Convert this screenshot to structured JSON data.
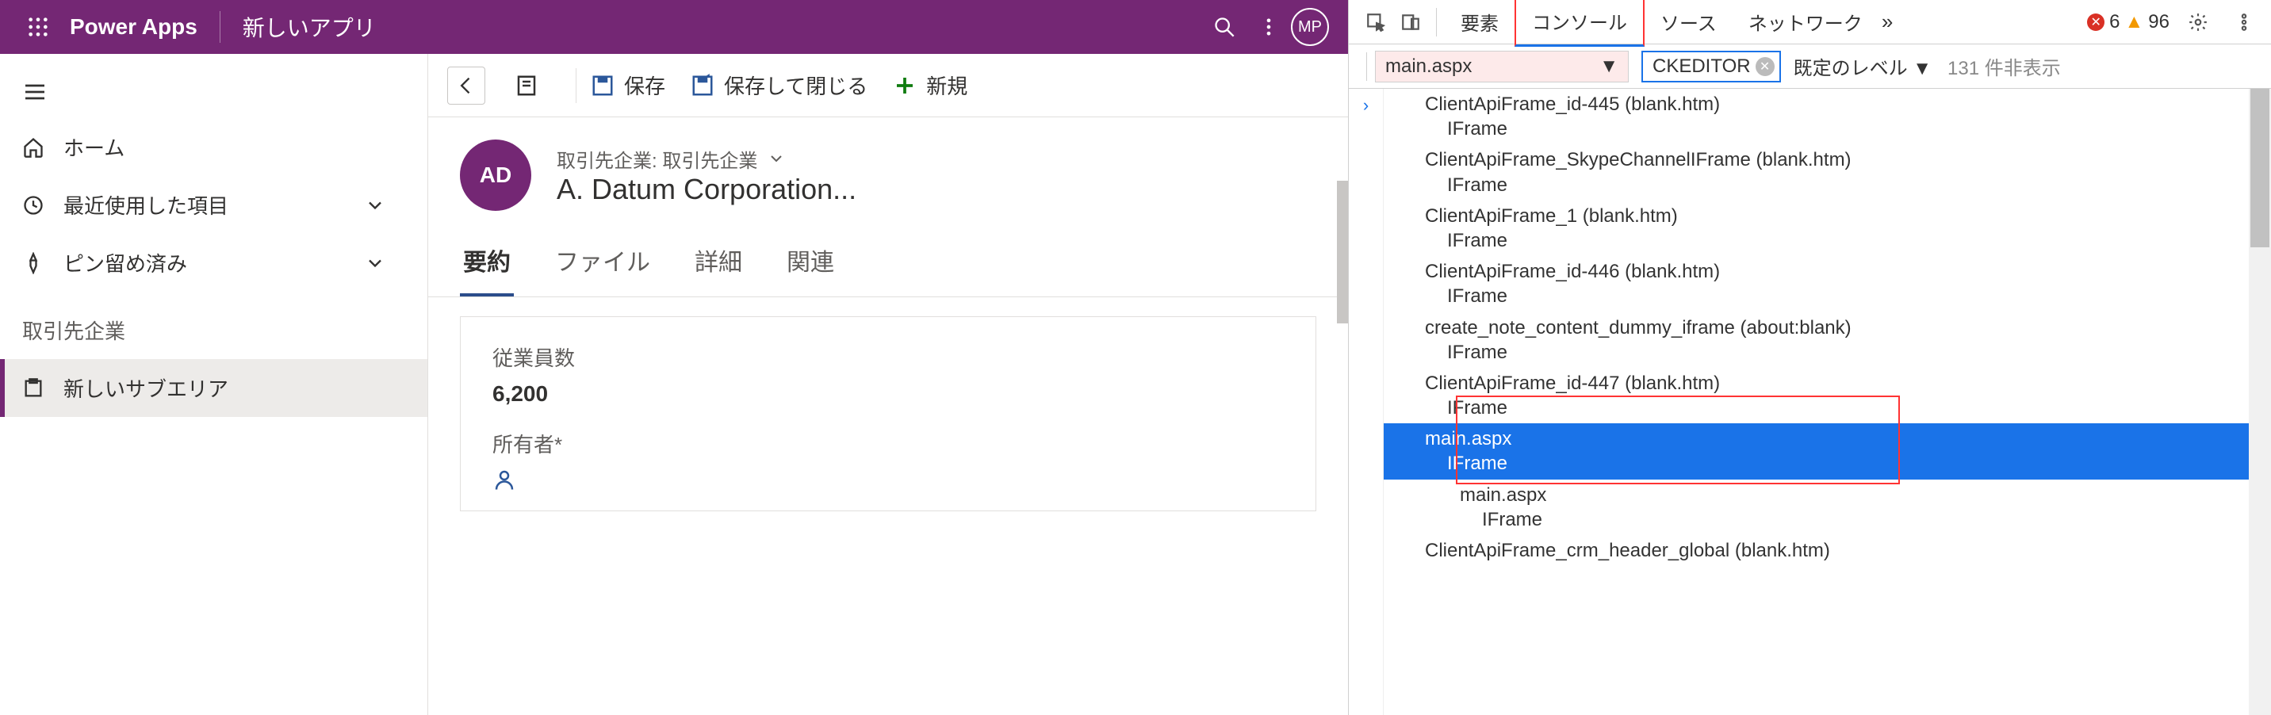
{
  "header": {
    "brand": "Power Apps",
    "app_title": "新しいアプリ",
    "avatar_initials": "MP"
  },
  "sidebar": {
    "items": [
      {
        "label": "ホーム"
      },
      {
        "label": "最近使用した項目"
      },
      {
        "label": "ピン留め済み"
      }
    ],
    "section_label": "取引先企業",
    "active_item": "新しいサブエリア"
  },
  "commandbar": {
    "save": "保存",
    "save_close": "保存して閉じる",
    "new": "新規"
  },
  "record": {
    "avatar": "AD",
    "type_label": "取引先企業: 取引先企業",
    "name": "A. Datum Corporation..."
  },
  "tabs": [
    "要約",
    "ファイル",
    "詳細",
    "関連"
  ],
  "form": {
    "employees_label": "従業員数",
    "employees_value": "6,200",
    "owner_label": "所有者*"
  },
  "devtools": {
    "tabs": {
      "elements": "要素",
      "console": "コンソール",
      "sources": "ソース",
      "network": "ネットワーク"
    },
    "more": "»",
    "error_count": "6",
    "warn_count": "96",
    "context": "main.aspx",
    "filter_value": "CKEDITOR",
    "level_label": "既定のレベル ▼",
    "hidden_label": "131 件非表示",
    "frames": [
      {
        "name": "ClientApiFrame_id-445 (blank.htm)",
        "type": "IFrame",
        "level": 1
      },
      {
        "name": "ClientApiFrame_SkypeChannelIFrame (blank.htm)",
        "type": "IFrame",
        "level": 1
      },
      {
        "name": "ClientApiFrame_1 (blank.htm)",
        "type": "IFrame",
        "level": 1
      },
      {
        "name": "ClientApiFrame_id-446 (blank.htm)",
        "type": "IFrame",
        "level": 1
      },
      {
        "name": "create_note_content_dummy_iframe (about:blank)",
        "type": "IFrame",
        "level": 1
      },
      {
        "name": "ClientApiFrame_id-447 (blank.htm)",
        "type": "IFrame",
        "level": 1
      },
      {
        "name": "main.aspx",
        "type": "IFrame",
        "level": 1,
        "selected": true
      },
      {
        "name": "main.aspx",
        "type": "IFrame",
        "level": 2
      },
      {
        "name": "ClientApiFrame_crm_header_global (blank.htm)",
        "type": "",
        "level": 1
      }
    ]
  }
}
